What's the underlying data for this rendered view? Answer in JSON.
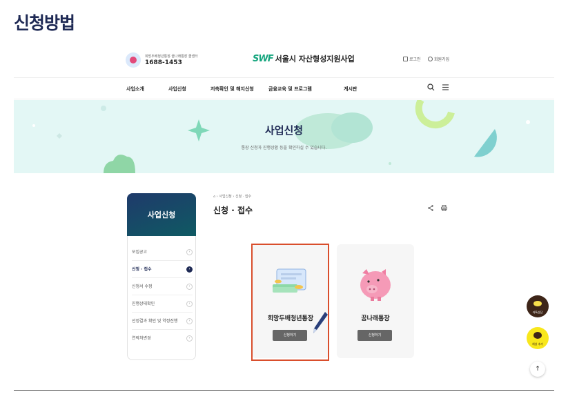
{
  "heading": "신청방법",
  "top": {
    "call_small": "희망두배청년통장·꿈나래통장 콜센터",
    "call_number": "1688-1453",
    "logo_mark": "SWF",
    "logo_text": "서울시 자산형성지원사업",
    "login": "로그인",
    "signup": "회원가입"
  },
  "nav": {
    "items": [
      "사업소개",
      "사업신청",
      "저축확인 및 해지신청",
      "금융교육 및 프로그램",
      "게시판"
    ],
    "search_icon": "search-icon",
    "menu_icon": "menu-icon"
  },
  "banner": {
    "title": "사업신청",
    "subtitle": "통장 신청과 진행상황 등을 확인하실 수 있습니다."
  },
  "sidebar": {
    "title": "사업신청",
    "items": [
      "모집공고",
      "신청 · 접수",
      "신청서 수정",
      "진행상태확인",
      "선정결과 확인 및 약정진행",
      "연락처변경"
    ],
    "active_index": 1
  },
  "content": {
    "breadcrumb": [
      "사업신청",
      "신청 · 접수"
    ],
    "title": "신청 · 접수"
  },
  "cards": [
    {
      "label": "희망두배청년통장",
      "button": "신청하기",
      "selected": true
    },
    {
      "label": "꿈나래통장",
      "button": "신청하기",
      "selected": false
    }
  ],
  "floating": {
    "kakao_talk": "카톡상담",
    "kakao_channel": "채널 추가"
  },
  "colors": {
    "heading": "#1f2a55",
    "banner_bg": "#e3f7f5",
    "highlight": "#d94e2c",
    "sidebar_head": "#1f3a6b"
  }
}
